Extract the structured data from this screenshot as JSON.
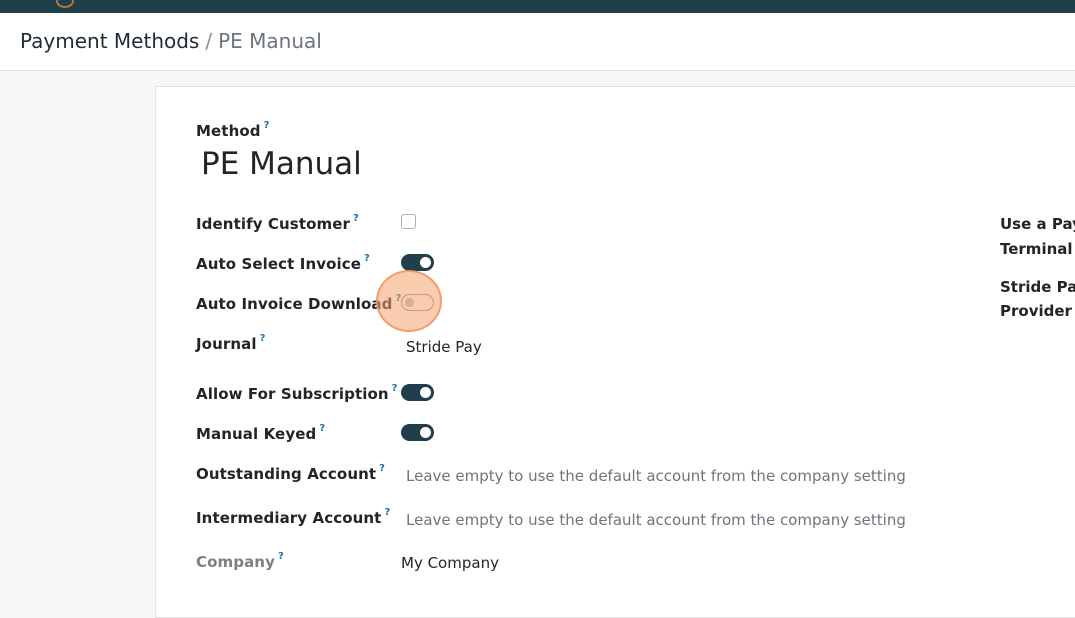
{
  "breadcrumb": {
    "parent": "Payment Methods",
    "separator": "/",
    "current": "PE Manual"
  },
  "form": {
    "method_label": "Method",
    "method_value": "PE Manual",
    "help_mark": "?",
    "fields": {
      "identify_customer": {
        "label": "Identify Customer",
        "checked": false
      },
      "auto_select_invoice": {
        "label": "Auto Select Invoice",
        "on": true
      },
      "auto_invoice_download": {
        "label": "Auto Invoice Download",
        "on": false
      },
      "journal": {
        "label": "Journal",
        "value": "Stride Pay"
      },
      "allow_for_subscription": {
        "label": "Allow For Subscription",
        "on": true
      },
      "manual_keyed": {
        "label": "Manual Keyed",
        "on": true
      },
      "outstanding_account": {
        "label": "Outstanding Account",
        "placeholder": "Leave empty to use the default account from the company setting"
      },
      "intermediary_account": {
        "label": "Intermediary Account",
        "placeholder": "Leave empty to use the default account from the company setting"
      },
      "company": {
        "label": "Company",
        "value": "My Company"
      }
    },
    "right_column": {
      "use_terminal_line1": "Use a Payr",
      "use_terminal_line2": "Terminal",
      "stride_provider_line1": "Stride Payr",
      "stride_provider_line2": "Provider"
    }
  },
  "colors": {
    "topbar": "#1f3f4a",
    "toggle_on": "#1f3f4a",
    "help": "#1a73a8",
    "highlight": "#f4a06e"
  }
}
